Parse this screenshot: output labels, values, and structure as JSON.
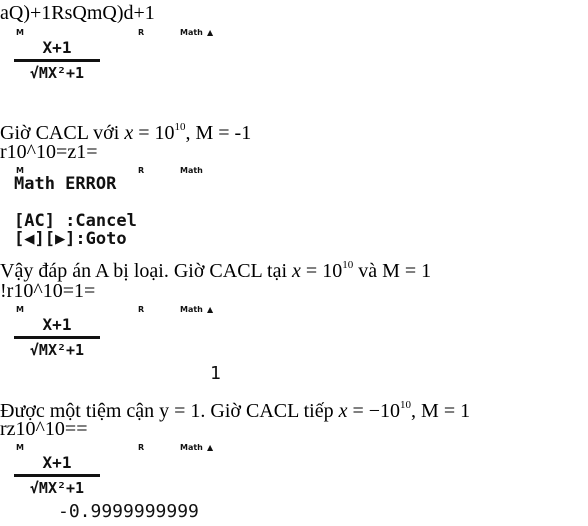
{
  "lines": {
    "l1": "aQ)+1RsQmQ)d+1",
    "l2a": "Giờ CACL với ",
    "l2x": "x",
    "l2eq": " = 10",
    "l2sup": "10",
    "l2b": ", M = -1",
    "l3": "r10^10=z1=",
    "l4a": "Vậy đáp án A bị loại. Giờ CACL tại ",
    "l4x": "x",
    "l4eq": " = 10",
    "l4sup": "10",
    "l4b": " và M = 1",
    "l5": "!r10^10=1=",
    "l6a": "Được một tiệm cận y = 1. Giờ CACL tiếp ",
    "l6x": "x",
    "l6eq": " = −10",
    "l6sup": "10",
    "l6b": ", M = 1",
    "l7": "rz10^10=="
  },
  "calc": {
    "ind_m": "M",
    "ind_r": "R",
    "ind_math": "Math",
    "ind_up": "▲",
    "numerator": "X+1",
    "denominator": "√MX²+1",
    "error_title": "Math ERROR",
    "err_ac": "[AC]  :Cancel",
    "err_goto": "[◀][▶]:Goto",
    "result1": "1",
    "result2": "-0.9999999999"
  }
}
